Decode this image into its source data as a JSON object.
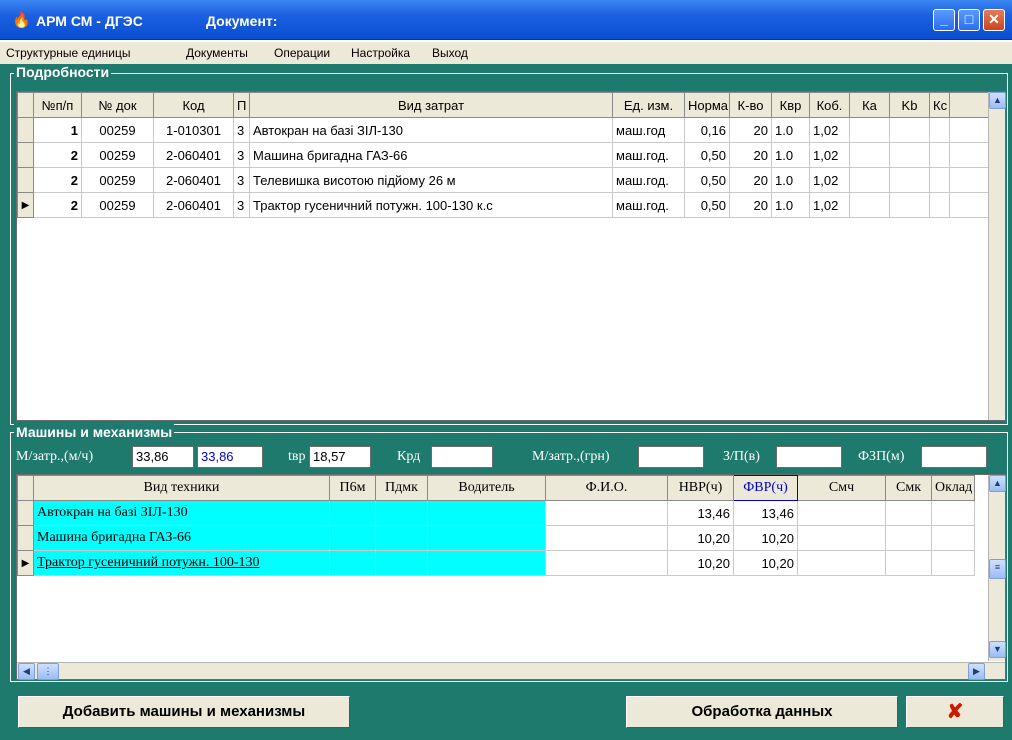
{
  "window": {
    "app_title": "АРМ СМ - ДГЭС",
    "document_label": "Документ:",
    "icon": "flame-app-icon",
    "controls": {
      "minimize": "_",
      "maximize": "□",
      "close": "✕"
    }
  },
  "menu": [
    "Структурные единицы",
    "Документы",
    "Операции",
    "Настройка",
    "Выход"
  ],
  "details": {
    "title": "Подробности",
    "headers": [
      "№п/п",
      "№ док",
      "Код",
      "П",
      "Вид затрат",
      "Ед. изм.",
      "Норма",
      "К-во",
      "Квр",
      "Коб.",
      "Ка",
      "Kb",
      "Кс"
    ],
    "rows": [
      [
        "1",
        "00259",
        "1-010301",
        "3",
        "Автокран на базі ЗІЛ-130",
        "маш.год",
        "0,16",
        "20",
        "1.0",
        "1,02",
        "",
        "",
        ""
      ],
      [
        "2",
        "00259",
        "2-060401",
        "3",
        "Машина бригадна ГАЗ-66",
        "маш.год.",
        "0,50",
        "20",
        "1.0",
        "1,02",
        "",
        "",
        ""
      ],
      [
        "2",
        "00259",
        "2-060401",
        "3",
        "Телевишка висотою підйому 26 м",
        "маш.год.",
        "0,50",
        "20",
        "1.0",
        "1,02",
        "",
        "",
        ""
      ],
      [
        "2",
        "00259",
        "2-060401",
        "3",
        "Трактор гусеничний потужн. 100-130 к.с",
        "маш.год.",
        "0,50",
        "20",
        "1.0",
        "1,02",
        "",
        "",
        ""
      ]
    ],
    "current_row": 3
  },
  "machines": {
    "title": "Машины и механизмы",
    "fields": {
      "mz_label": "М/затр.,(м/ч)",
      "mz_value1": "33,86",
      "mz_value2": "33,86",
      "tvr_label": "tвр",
      "tvr_value": "18,57",
      "krd_label": "Крд",
      "krd_value": "",
      "mzgrn_label": "М/затр.,(грн)",
      "mzgrn_value": "",
      "zp_label": "З/П(в)",
      "zp_value": "",
      "fzp_label": "ФЗП(м)",
      "fzp_value": ""
    },
    "headers": [
      "Вид техники",
      "П6м",
      "Пдмк",
      "Водитель",
      "Ф.И.О.",
      "НВР(ч)",
      "ФВР(ч)",
      "Смч",
      "Смк",
      "Оклад"
    ],
    "rows": [
      [
        "Автокран на базі ЗІЛ-130",
        "",
        "",
        "",
        "",
        "13,46",
        "13,46",
        "",
        "",
        ""
      ],
      [
        "Машина бригадна ГАЗ-66",
        "",
        "",
        "",
        "",
        "10,20",
        "10,20",
        "",
        "",
        ""
      ],
      [
        "Трактор гусеничний потужн. 100-130",
        "",
        "",
        "",
        "",
        "10,20",
        "10,20",
        "",
        "",
        ""
      ]
    ],
    "current_row": 2
  },
  "buttons": {
    "add": "Добавить машины и механизмы",
    "process": "Обработка данных",
    "cancel": "✘"
  },
  "colors": {
    "teal": "#1f7a6e",
    "cyan": "#00ffff",
    "titlebar": "#0a4ed2",
    "fvr_header": "#0000cc"
  }
}
